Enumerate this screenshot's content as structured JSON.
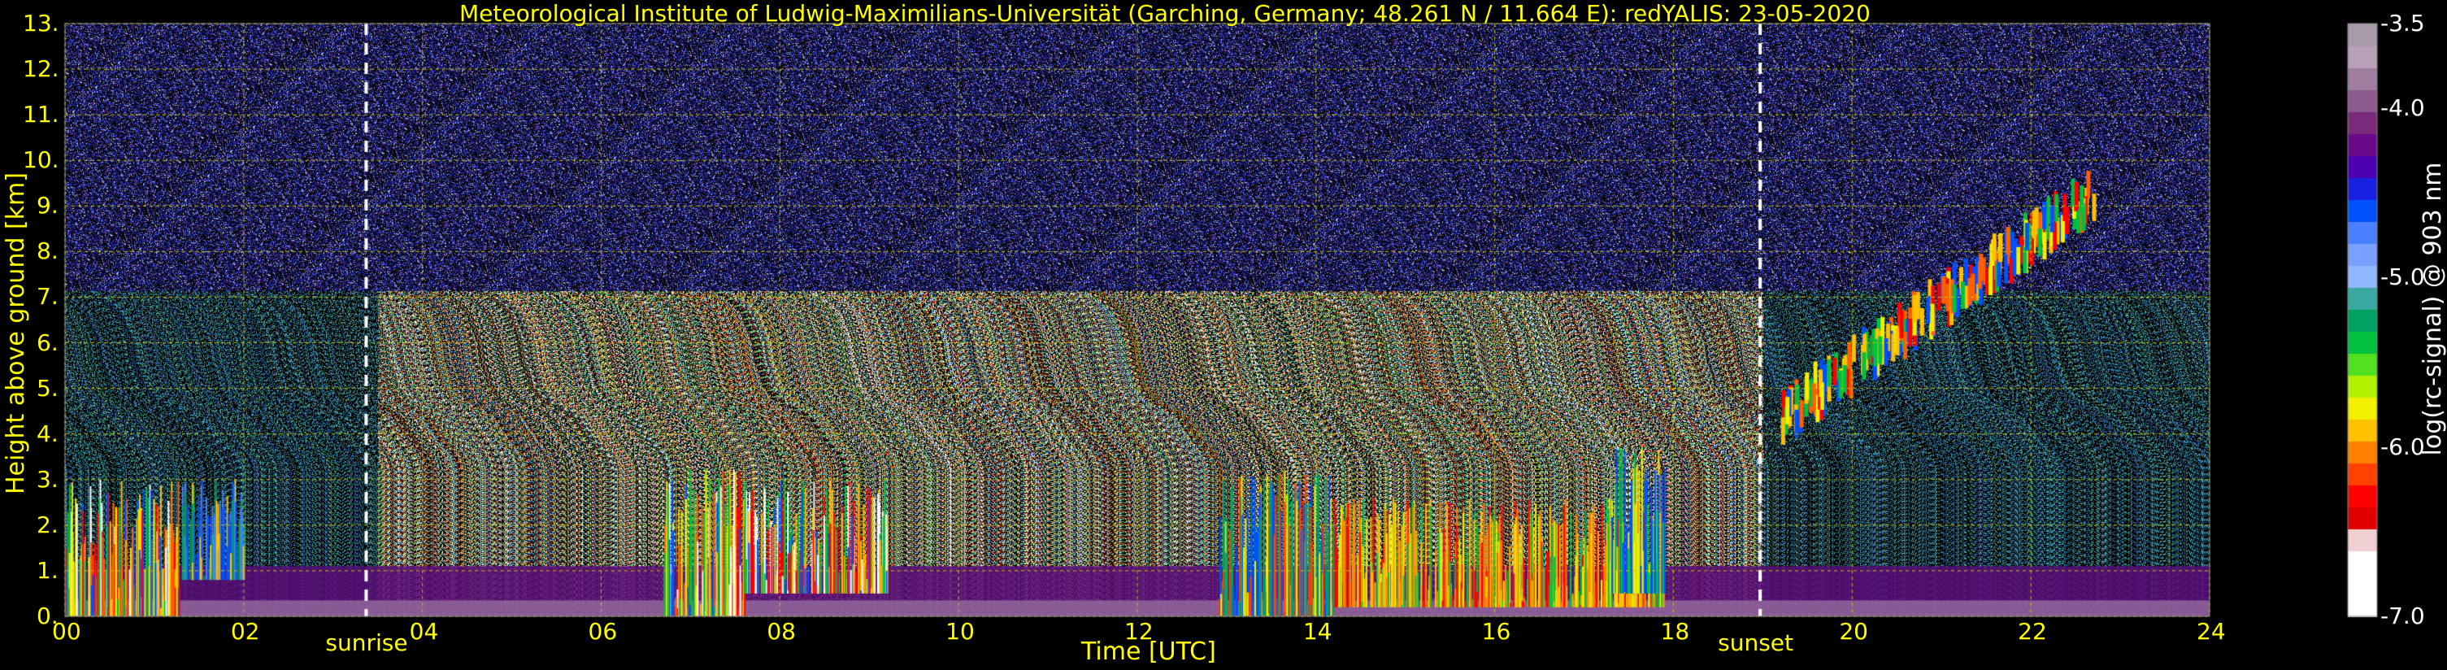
{
  "title": "Meteorological Institute of Ludwig-Maximilians-Universität (Garching, Germany; 48.261 N / 11.664 E):    redYALIS: 23-05-2020",
  "chart_data": {
    "type": "heatmap",
    "title": "Meteorological Institute of Ludwig-Maximilians-Universität (Garching, Germany; 48.261 N / 11.664 E):    redYALIS: 23-05-2020",
    "xlabel": "Time [UTC]",
    "ylabel": "Height above ground [km]",
    "xlim": [
      0,
      24
    ],
    "ylim": [
      0,
      13
    ],
    "x_ticks": [
      "00",
      "02",
      "04",
      "06",
      "08",
      "10",
      "12",
      "14",
      "16",
      "18",
      "20",
      "22",
      "24"
    ],
    "y_ticks": [
      "0.",
      "1.",
      "2.",
      "3.",
      "4.",
      "5.",
      "6.",
      "7.",
      "8.",
      "9.",
      "10.",
      "11.",
      "12.",
      "13."
    ],
    "grid": true,
    "colorbar": {
      "label": "log(rc-signal) @ 903 nm",
      "range": [
        -7.0,
        -3.5
      ],
      "ticks": [
        "-3.5",
        "-4.0",
        "-5.0",
        "-6.0",
        "-7.0"
      ],
      "tick_values": [
        -3.5,
        -4.0,
        -5.0,
        -6.0,
        -7.0
      ],
      "colors": [
        "#a89aa8",
        "#b8a0b8",
        "#a07ea0",
        "#8c5a8c",
        "#7a2a7a",
        "#6a0a8a",
        "#4a00b0",
        "#1a20e0",
        "#0050ff",
        "#4a80ff",
        "#7aa0ff",
        "#90b8ff",
        "#3aa8a0",
        "#00a060",
        "#00c040",
        "#50e020",
        "#b0f000",
        "#f0f000",
        "#ffc000",
        "#ff8000",
        "#ff4000",
        "#ff0000",
        "#e00000",
        "#f0d0d0",
        "#ffffff",
        "#ffffff",
        "#ffffff"
      ]
    },
    "events": [
      {
        "label": "sunrise",
        "x": 3.37
      },
      {
        "label": "sunset",
        "x": 18.97
      }
    ]
  }
}
